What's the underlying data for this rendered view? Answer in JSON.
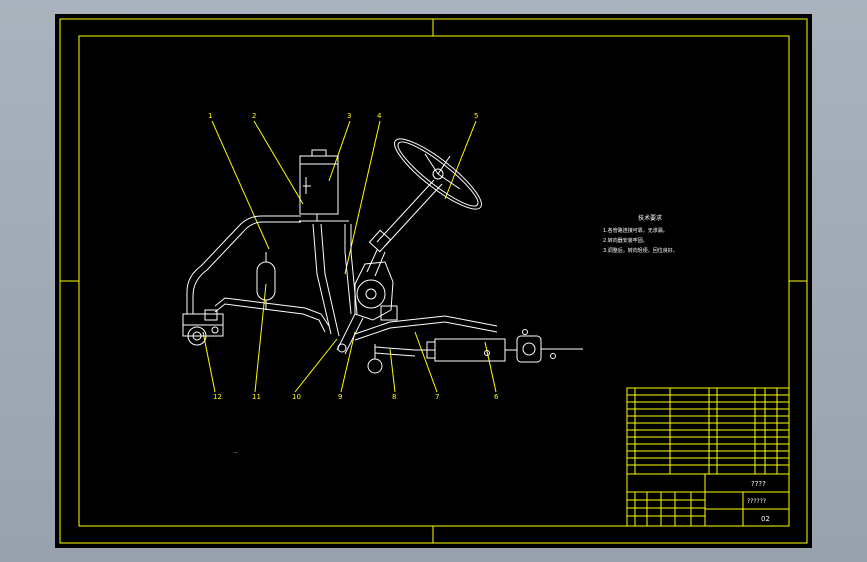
{
  "part_labels": [
    "1",
    "2",
    "3",
    "4",
    "5",
    "12",
    "11",
    "10",
    "9",
    "8",
    "7",
    "6"
  ],
  "tech_notes": {
    "heading": "技术要求",
    "line1": "1.各管路连接可靠，无渗漏。",
    "line2": "2.转向器安装牢固。",
    "line3": "3.调整后，转向轻便，回位良好。"
  },
  "title_block": {
    "drawing_title": "????",
    "subtitle": "??????",
    "sheet_code": "02",
    "small_mark": "..."
  },
  "colors": {
    "sheet": "#000000",
    "frame": "#ffff00",
    "linework": "#ffffff",
    "window_bg": "#a0a9b4"
  }
}
